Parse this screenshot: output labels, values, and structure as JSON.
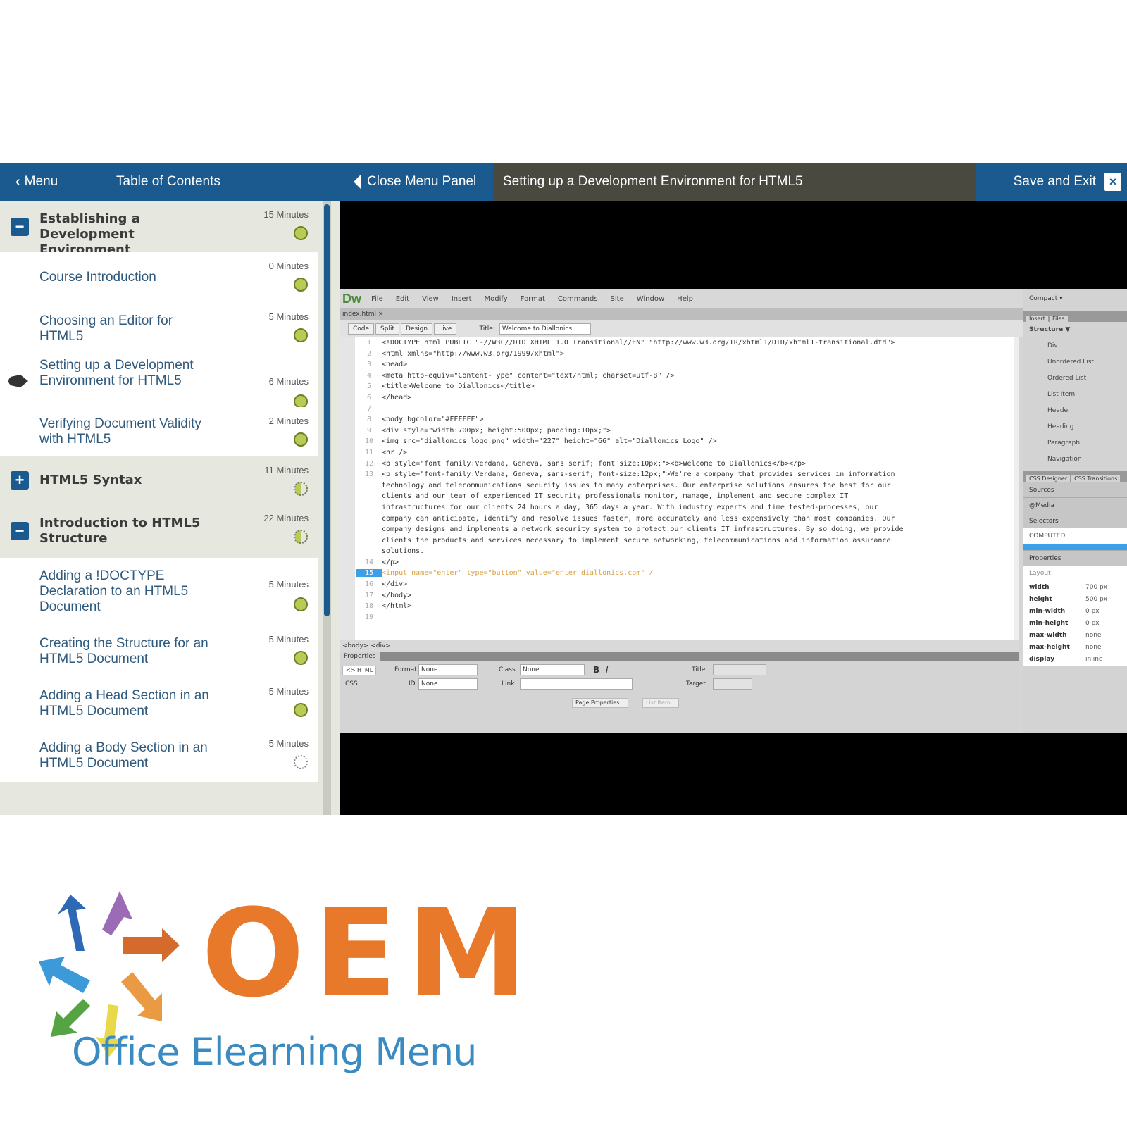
{
  "topbar": {
    "menu_label": "Menu",
    "toc_label": "Table of Contents",
    "close_panel_label": "Close Menu Panel",
    "current_title": "Setting up a Development Environment for HTML5",
    "save_exit_label": "Save and Exit",
    "close_icon": "×"
  },
  "sidebar": {
    "rows": [
      {
        "type": "section",
        "toggle": "−",
        "title": "Establishing a Development Environment",
        "duration": "15 Minutes",
        "status": "done"
      },
      {
        "type": "lesson",
        "title": "Course Introduction",
        "duration": "0 Minutes",
        "status": "done"
      },
      {
        "type": "lesson",
        "title": "Choosing an Editor for HTML5",
        "duration": "5 Minutes",
        "status": "done"
      },
      {
        "type": "lesson",
        "title": "Setting up a Development Environment for HTML5",
        "duration": "6 Minutes",
        "status": "done",
        "current": true
      },
      {
        "type": "lesson",
        "title": "Verifying Document Validity with HTML5",
        "duration": "2 Minutes",
        "status": "done"
      },
      {
        "type": "section",
        "toggle": "+",
        "title": "HTML5 Syntax",
        "duration": "11 Minutes",
        "status": "half"
      },
      {
        "type": "section",
        "toggle": "−",
        "title": "Introduction to HTML5 Structure",
        "duration": "22 Minutes",
        "status": "half"
      },
      {
        "type": "lesson",
        "title": "Adding a !DOCTYPE Declaration to an HTML5 Document",
        "duration": "5 Minutes",
        "status": "done"
      },
      {
        "type": "lesson",
        "title": "Creating the Structure for an HTML5 Document",
        "duration": "5 Minutes",
        "status": "done"
      },
      {
        "type": "lesson",
        "title": "Adding a Head Section in an HTML5 Document",
        "duration": "5 Minutes",
        "status": "done"
      },
      {
        "type": "lesson",
        "title": "Adding a Body Section in an HTML5 Document",
        "duration": "5 Minutes",
        "status": "none"
      }
    ]
  },
  "editor": {
    "app_logo": "Dw",
    "menus": [
      "File",
      "Edit",
      "View",
      "Insert",
      "Modify",
      "Format",
      "Commands",
      "Site",
      "Window",
      "Help"
    ],
    "doc_tab": "index.html ×",
    "view_buttons": [
      "Code",
      "Split",
      "Design",
      "Live"
    ],
    "title_label": "Title:",
    "title_value": "Welcome to Diallonics",
    "workspace": "Compact ▾",
    "code_lines": [
      {
        "n": "1",
        "text": "<!DOCTYPE html PUBLIC \"-//W3C//DTD XHTML 1.0 Transitional//EN\" \"http://www.w3.org/TR/xhtml1/DTD/xhtml1-transitional.dtd\">"
      },
      {
        "n": "2",
        "text": "<html xmlns=\"http://www.w3.org/1999/xhtml\">"
      },
      {
        "n": "3",
        "text": "<head>"
      },
      {
        "n": "4",
        "text": "<meta http-equiv=\"Content-Type\" content=\"text/html; charset=utf-8\" />"
      },
      {
        "n": "5",
        "text": "<title>Welcome to Diallonics</title>"
      },
      {
        "n": "6",
        "text": "</head>"
      },
      {
        "n": "7",
        "text": ""
      },
      {
        "n": "8",
        "text": "<body bgcolor=\"#FFFFFF\">"
      },
      {
        "n": "9",
        "text": "<div style=\"width:700px; height:500px; padding:10px;\">"
      },
      {
        "n": "10",
        "text": "<img src=\"diallonics logo.png\" width=\"227\" height=\"66\" alt=\"Diallonics Logo\" />"
      },
      {
        "n": "11",
        "text": "<hr />"
      },
      {
        "n": "12",
        "text": "<p style=\"font family:Verdana, Geneva, sans serif; font size:10px;\"><b>Welcome to Diallonics</b></p>"
      },
      {
        "n": "13",
        "text": "<p style=\"font-family:Verdana, Geneva, sans-serif; font-size:12px;\">We're a company that provides services in information"
      },
      {
        "n": "",
        "text": "technology and telecommunications security issues to many enterprises. Our enterprise solutions ensures the best for our"
      },
      {
        "n": "",
        "text": "clients and our team of experienced IT security professionals monitor, manage, implement and secure complex IT"
      },
      {
        "n": "",
        "text": "infrastructures for our clients 24 hours a day, 365 days a year. With industry experts and time tested-processes, our"
      },
      {
        "n": "",
        "text": "company can anticipate, identify and resolve issues faster, more accurately and less expensively than most companies. Our"
      },
      {
        "n": "",
        "text": "company designs and implements a network security system to protect our clients IT infrastructures. By so doing, we provide"
      },
      {
        "n": "",
        "text": "clients the products and services necessary to implement secure networking, telecommunications and information assurance"
      },
      {
        "n": "",
        "text": "solutions."
      },
      {
        "n": "14",
        "text": "</p>"
      },
      {
        "n": "15",
        "text": "<input name=\"enter\" type=\"button\" value=\"enter diallonics.com\" /",
        "active": true
      },
      {
        "n": "16",
        "text": "</div>"
      },
      {
        "n": "17",
        "text": "</body>"
      },
      {
        "n": "18",
        "text": "</html>"
      },
      {
        "n": "19",
        "text": ""
      }
    ],
    "status_path": "<body> <div>",
    "properties": {
      "tab": "Properties",
      "html_btn": "<> HTML",
      "css_btn": "CSS",
      "format_label": "Format",
      "format_value": "None",
      "class_label": "Class",
      "class_value": "None",
      "id_label": "ID",
      "id_value": "None",
      "link_label": "Link",
      "link_value": "",
      "title_label": "Title",
      "target_label": "Target",
      "bold": "B",
      "italic": "I",
      "page_props_btn": "Page Properties...",
      "list_item_btn": "List Item..."
    },
    "right_panel": {
      "tabs": [
        "Insert",
        "Files"
      ],
      "category": "Structure ▼",
      "items": [
        "Div",
        "Unordered List",
        "Ordered List",
        "List Item",
        "Header",
        "Heading",
        "Paragraph",
        "Navigation"
      ],
      "css_tabs": [
        "CSS Designer",
        "CSS Transitions"
      ],
      "sections": [
        "Sources",
        "@Media",
        "Selectors"
      ],
      "computed": "COMPUTED",
      "properties_label": "Properties",
      "layout_label": "Layout",
      "props": [
        {
          "k": "width",
          "v": "700 px"
        },
        {
          "k": "height",
          "v": "500 px"
        },
        {
          "k": "min-width",
          "v": "0 px"
        },
        {
          "k": "min-height",
          "v": "0 px"
        },
        {
          "k": "max-width",
          "v": "none"
        },
        {
          "k": "max-height",
          "v": "none"
        },
        {
          "k": "display",
          "v": "inline"
        }
      ]
    }
  },
  "logo": {
    "brand": "OEM",
    "subtitle": "Office Elearning Menu",
    "brand_color": "#e8792a",
    "subtitle_color": "#3a8bc2"
  }
}
